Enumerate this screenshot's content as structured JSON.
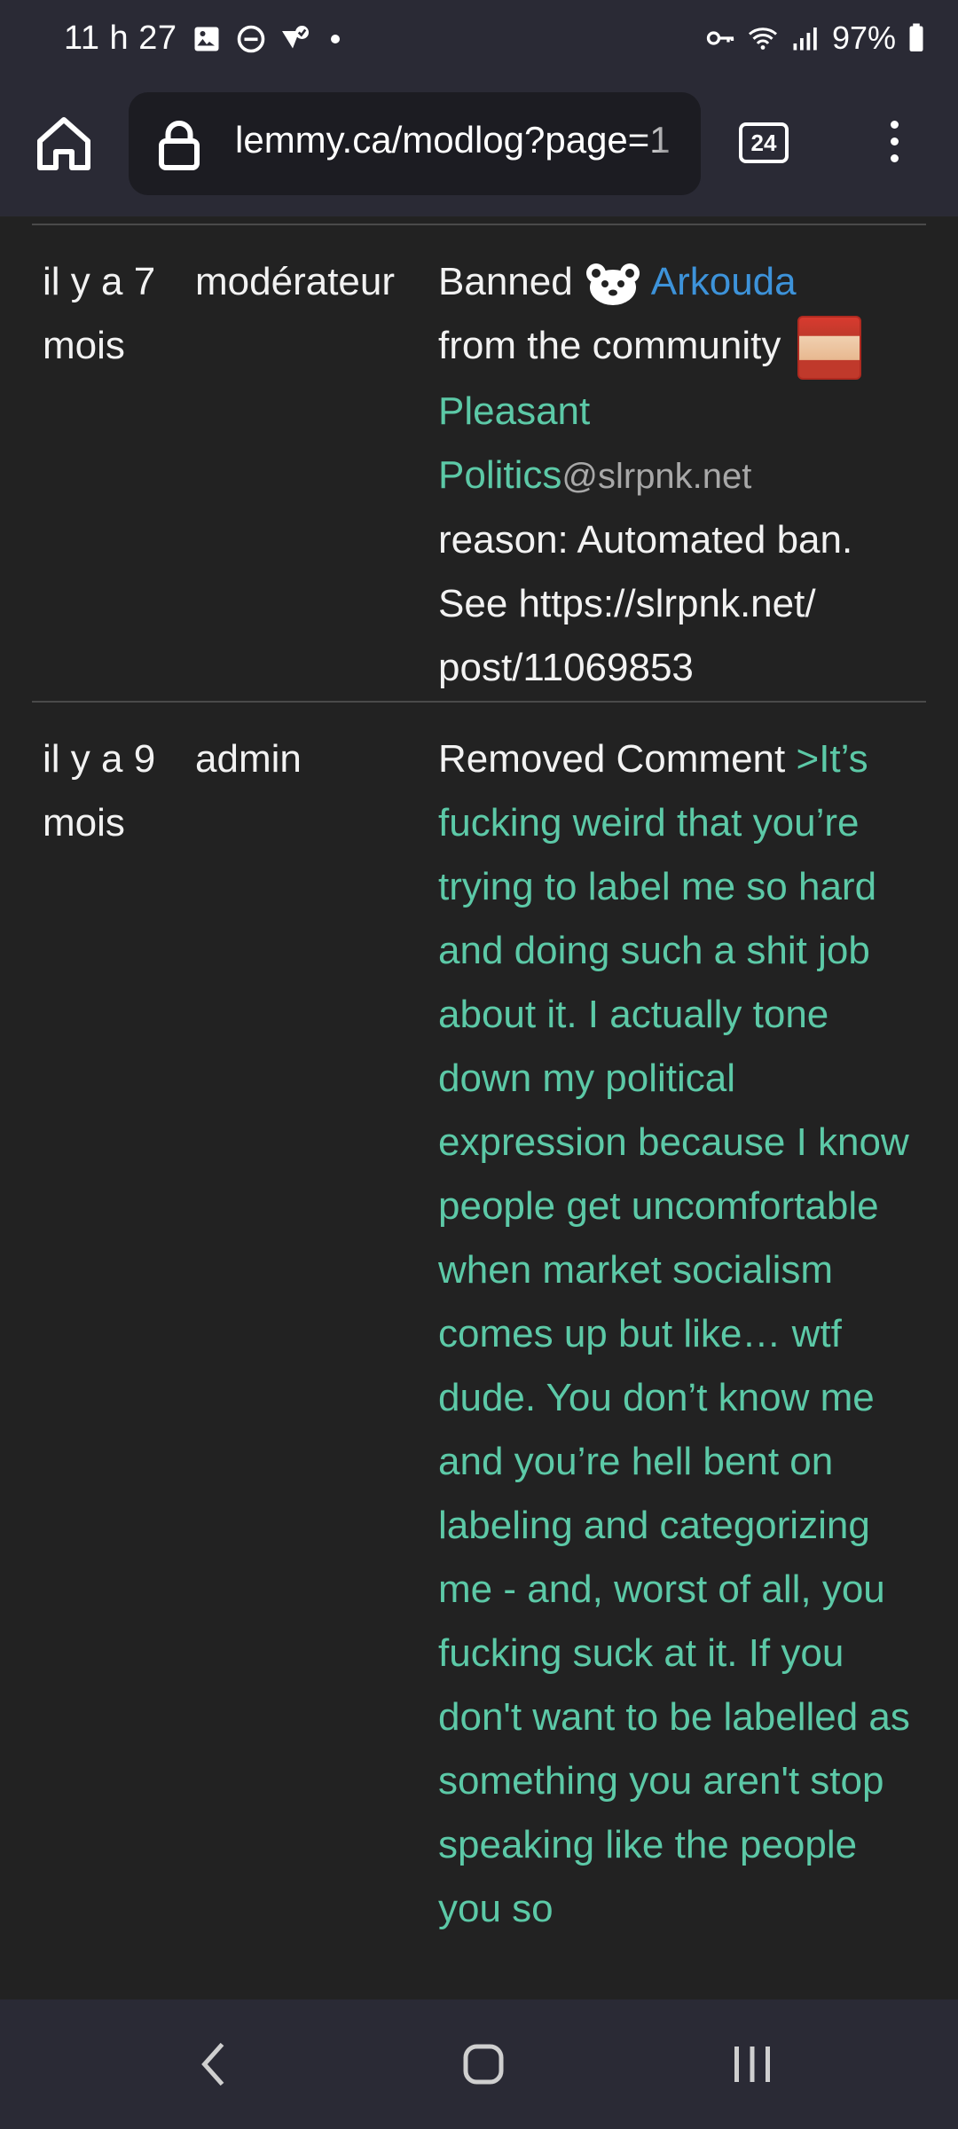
{
  "status_bar": {
    "time": "11 h 27",
    "battery": "97%",
    "icons_left": [
      "image-icon",
      "dnd-icon",
      "vpn-icon",
      "dot-icon"
    ],
    "icons_right": [
      "key-icon",
      "wifi-icon",
      "signal-icon",
      "battery-icon"
    ]
  },
  "browser": {
    "url": "lemmy.ca/modlog?page=1",
    "tab_count": "24"
  },
  "modlog": {
    "entries": [
      {
        "time_line1": "il y a 7",
        "time_line2": "mois",
        "role": "modérateur",
        "action_prefix": "Banned",
        "user": "Arkouda",
        "from_text": "from the community",
        "community": "Pleasant Politics",
        "community_line1": "Pleasant",
        "community_line2": "Politics",
        "instance": "@slrpnk.net",
        "reason": "reason: Automated ban. See https://slrpnk.net/ post/11069853"
      },
      {
        "time_line1": "il y a 9",
        "time_line2": "mois",
        "role": "admin",
        "action_prefix": "Removed Comment",
        "comment": ">It’s fucking weird that you’re trying to label me so hard and doing such a shit job about it. I actually tone down my political expression because I know people get uncomfortable when market socialism comes up but like… wtf dude. You don’t know me and you’re hell bent on labeling and categorizing me - and, worst of all, you fucking suck at it. If you don't want to be labelled as something you aren't stop speaking like the people you so"
      }
    ]
  },
  "colors": {
    "background": "#222222",
    "bars": "#2a2a35",
    "link_blue": "#3d93da",
    "link_green": "#5cc9a7"
  }
}
